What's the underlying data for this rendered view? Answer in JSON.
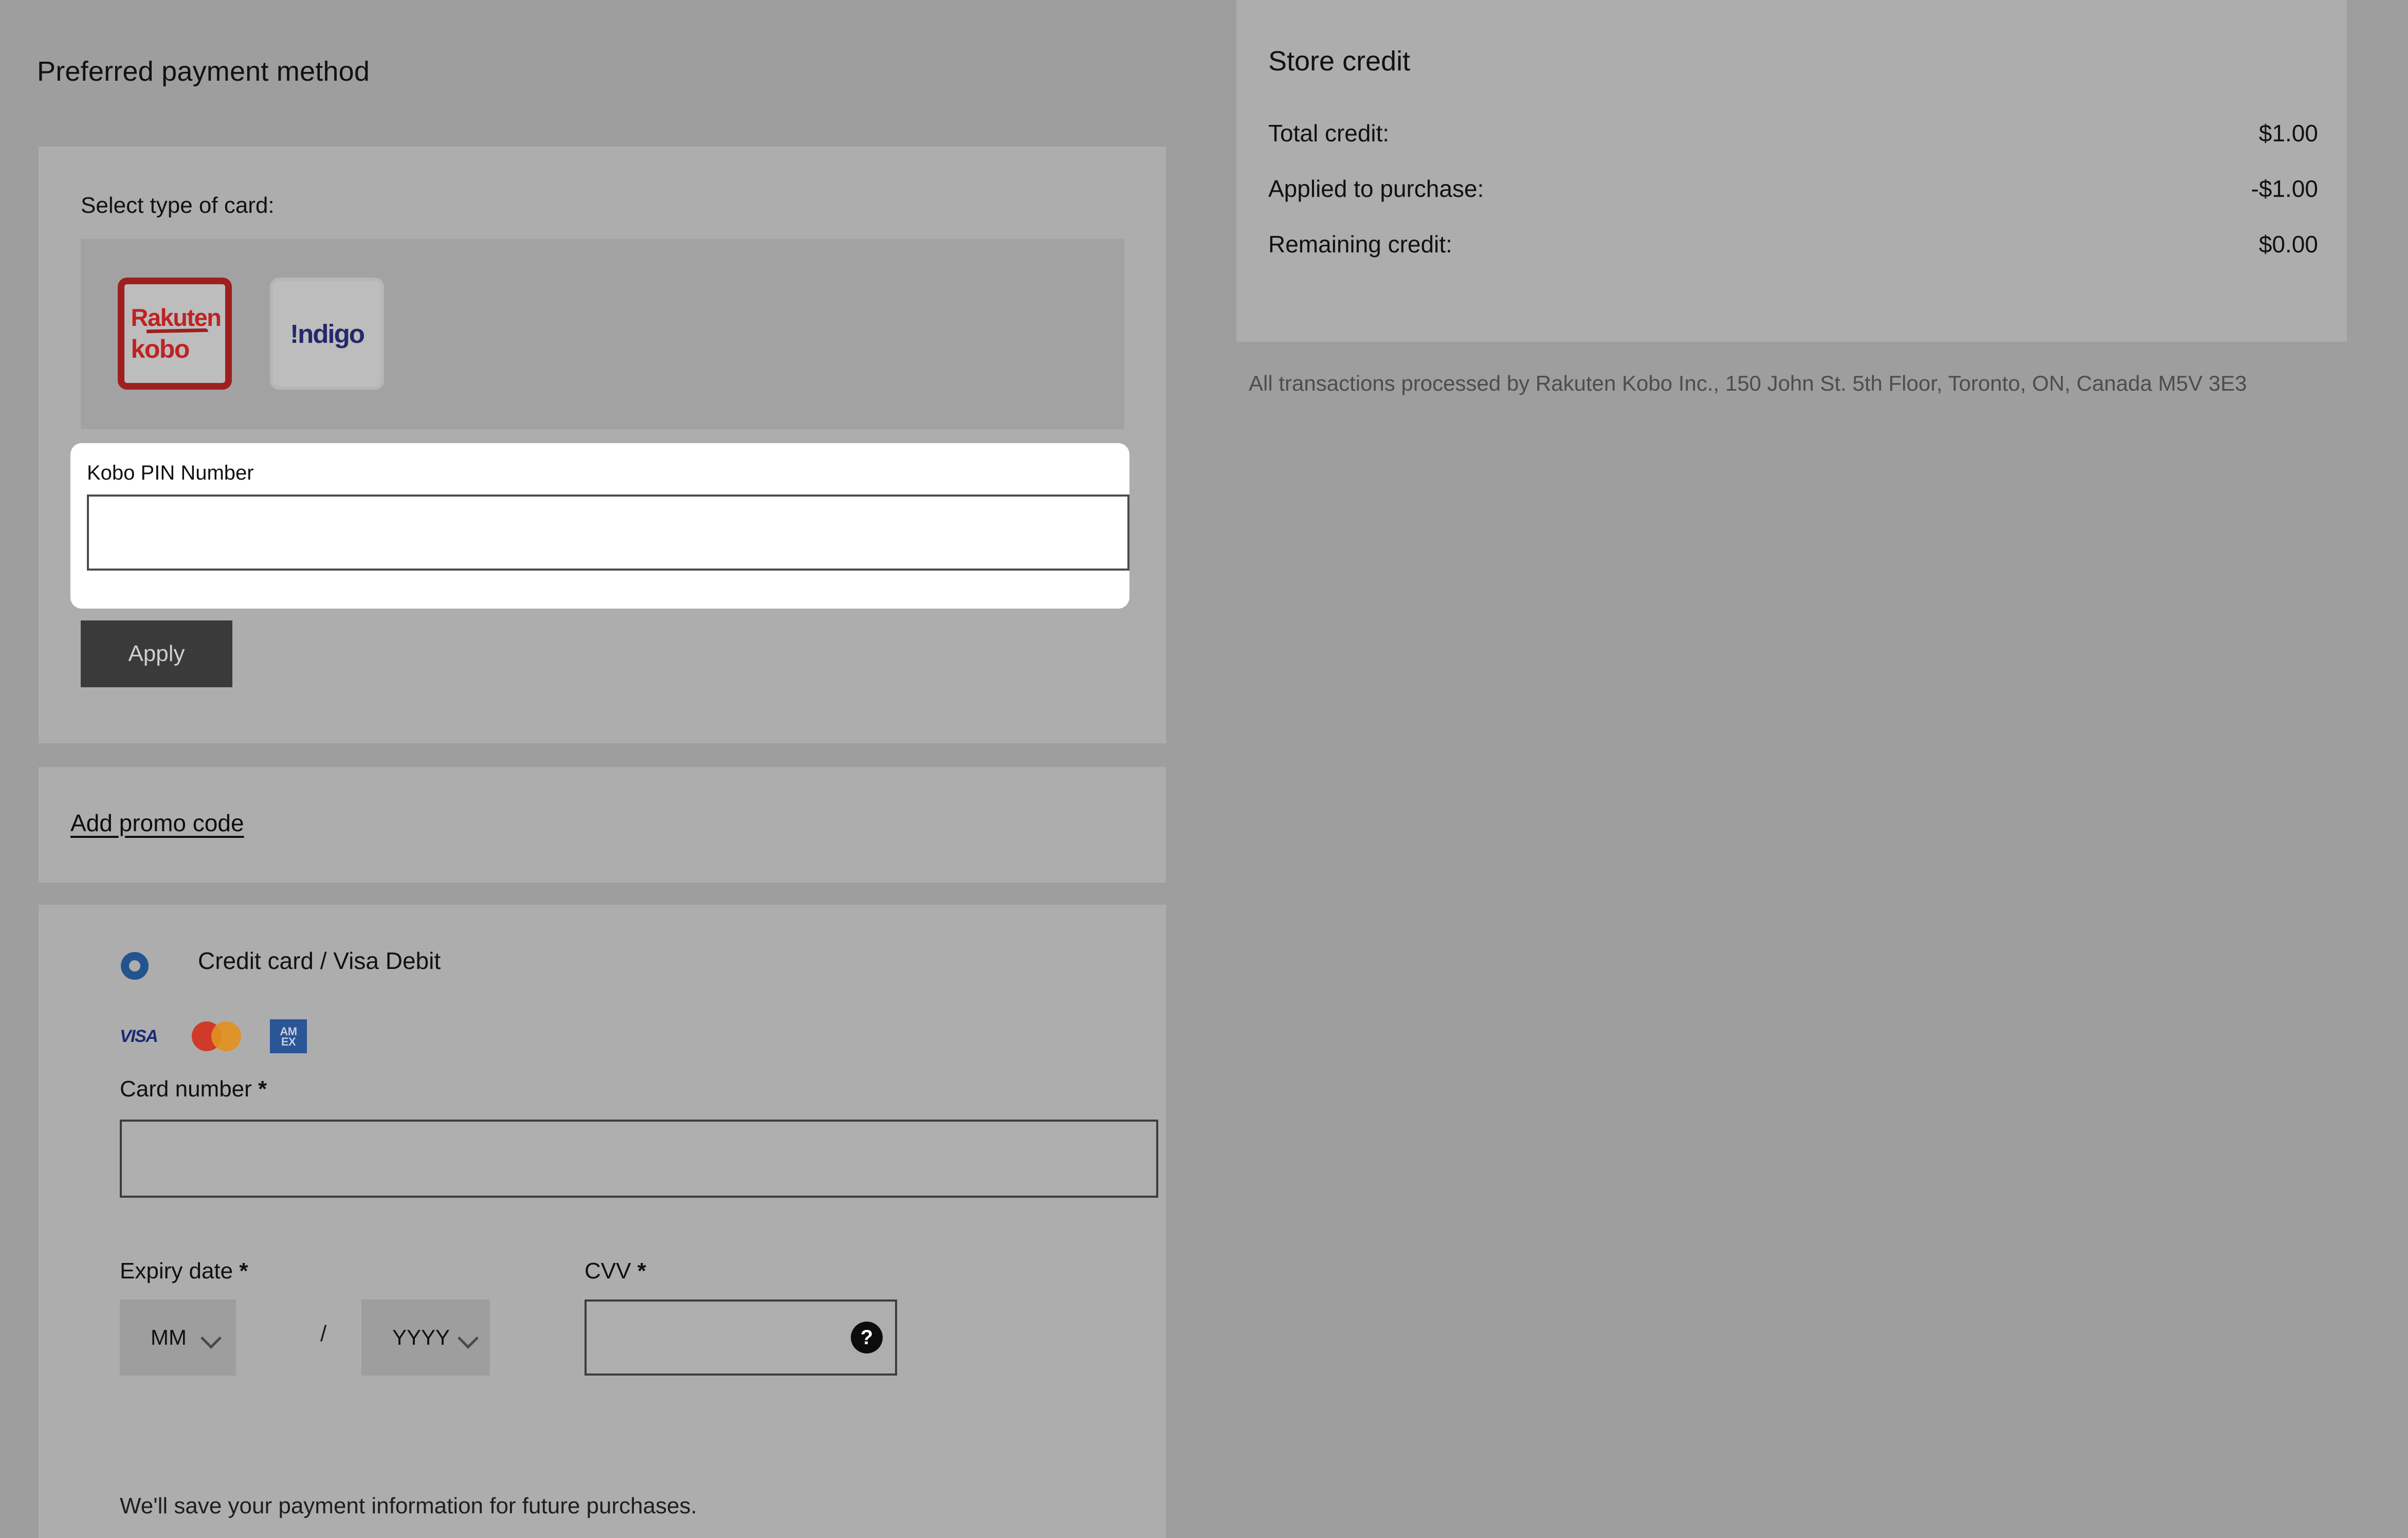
{
  "page": {
    "title": "Preferred payment method"
  },
  "card_type_section": {
    "label": "Select type of card:",
    "options": [
      {
        "name": "rakuten-kobo",
        "line1": "Rakuten",
        "line2": "kobo",
        "selected": true
      },
      {
        "name": "indigo",
        "text": "!ndigo",
        "selected": false
      }
    ],
    "pin": {
      "label": "Kobo PIN Number",
      "value": "",
      "placeholder": ""
    },
    "apply_label": "Apply"
  },
  "promo_section": {
    "link_label": "Add promo code"
  },
  "credit_card_section": {
    "radio_label": "Credit card / Visa Debit",
    "brands": [
      {
        "name": "visa",
        "text": "VISA"
      },
      {
        "name": "mastercard",
        "text": ""
      },
      {
        "name": "amex",
        "line1": "AM",
        "line2": "EX"
      }
    ],
    "card_number": {
      "label": "Card number",
      "required_mark": "*",
      "value": "",
      "placeholder": ""
    },
    "expiry": {
      "label": "Expiry date",
      "required_mark": "*",
      "month_value": "MM",
      "year_value": "YYYY",
      "separator": "/"
    },
    "cvv": {
      "label": "CVV",
      "required_mark": "*",
      "value": "",
      "placeholder": "",
      "help_glyph": "?"
    },
    "save_note": "We'll save your payment information for future purchases."
  },
  "store_credit": {
    "title": "Store credit",
    "rows": [
      {
        "label": "Total credit:",
        "value": "$1.00"
      },
      {
        "label": "Applied to purchase:",
        "value": "-$1.00"
      },
      {
        "label": "Remaining credit:",
        "value": "$0.00"
      }
    ]
  },
  "legal": {
    "text": "All transactions processed by Rakuten Kobo Inc., 150 John St. 5th Floor, Toronto, ON, Canada M5V 3E3"
  },
  "colors": {
    "page_bg": "#9e9e9e",
    "card_bg": "#adadad",
    "kobo_red": "#bf2222",
    "kobo_border": "#9e1f1f",
    "indigo_blue": "#27276b",
    "radio_blue": "#22558f",
    "apply_bg": "#3a3a3a",
    "visa_blue": "#1a2a7a",
    "mc_red": "#cf3b28",
    "mc_yellow": "#e2901f",
    "amex_blue": "#2a5596"
  }
}
